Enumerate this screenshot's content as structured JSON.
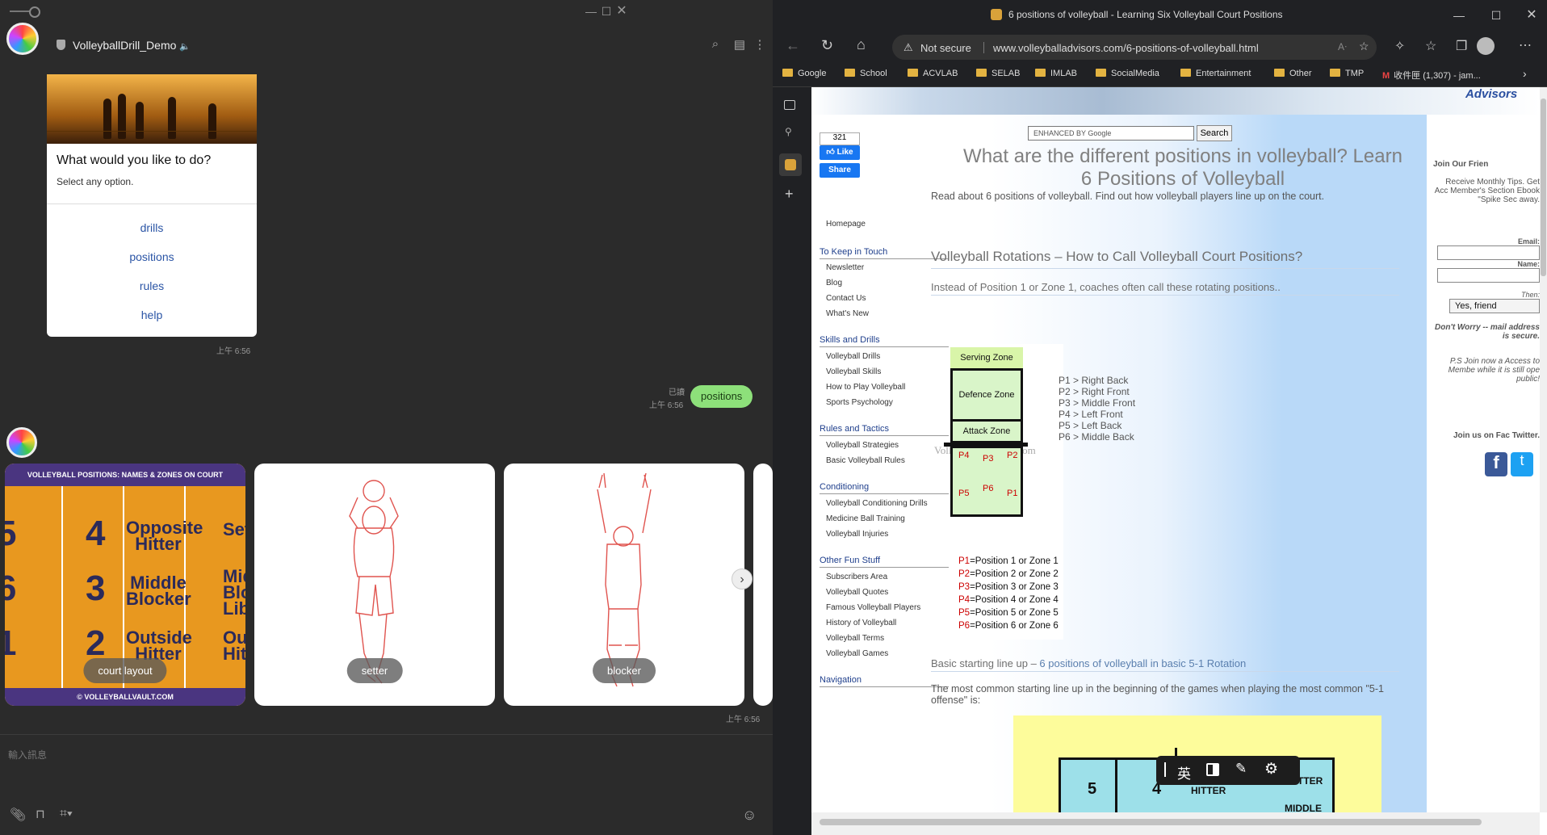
{
  "line": {
    "chat_title": "VolleyballDrill_Demo",
    "card": {
      "title": "What would you like to do?",
      "subtitle": "Select any option.",
      "options": [
        "drills",
        "positions",
        "rules",
        "help"
      ],
      "time": "上午 6:56"
    },
    "sent": {
      "text": "positions",
      "read": "已讀",
      "time": "上午 6:56"
    },
    "carousel": [
      {
        "label": "court layout"
      },
      {
        "label": "setter"
      },
      {
        "label": "blocker"
      }
    ],
    "carousel_time": "上午 6:56",
    "court_image": {
      "header": "VOLLEYBALL POSITIONS: NAMES & ZONES ON COURT",
      "footer": "© VOLLEYBALLVAULT.COM",
      "numbers": [
        "4",
        "3",
        "2",
        "5",
        "6",
        "1"
      ],
      "names": [
        "Opposite Hitter",
        "Middle Blocker",
        "Outside Hitter",
        "Set",
        "Mid Bloc Libe",
        "Out Hit"
      ]
    },
    "input_placeholder": "輸入訊息"
  },
  "browser": {
    "tab_title": "6 positions of volleyball - Learning Six Volleyball Court Positions",
    "not_secure": "Not secure",
    "url": "www.volleyballadvisors.com/6-positions-of-volleyball.html",
    "bookmarks": [
      "Google",
      "School",
      "ACVLAB",
      "SELAB",
      "IMLAB",
      "SocialMedia",
      "Entertainment",
      "Other",
      "TMP",
      "收件匣 (1,307) - jam..."
    ],
    "page": {
      "logo_text": "Advisors",
      "like_count": "321",
      "like_label": "Like",
      "share_label": "Share",
      "search_placeholder": "ENHANCED BY Google",
      "search_button": "Search",
      "heading": "What are the different positions in volleyball? Learn 6 Positions of Volleyball",
      "intro": "Read about 6 positions of volleyball. Find out how volleyball players line up on the court.",
      "nav": {
        "homepage": "Homepage",
        "sections": [
          {
            "title": "To Keep in Touch",
            "items": [
              "Newsletter",
              "Blog",
              "Contact Us",
              "What's New"
            ]
          },
          {
            "title": "Skills and Drills",
            "items": [
              "Volleyball Drills",
              "Volleyball Skills",
              "How to Play Volleyball",
              "Sports Psychology"
            ]
          },
          {
            "title": "Rules and Tactics",
            "items": [
              "Volleyball Strategies",
              "Basic Volleyball Rules"
            ]
          },
          {
            "title": "Conditioning",
            "items": [
              "Volleyball Conditioning Drills",
              "Medicine Ball Training",
              "Volleyball Injuries"
            ]
          },
          {
            "title": "Other Fun Stuff",
            "items": [
              "Subscribers Area",
              "Volleyball Quotes",
              "Famous Volleyball Players",
              "History of Volleyball",
              "Volleyball Terms",
              "Volleyball Games"
            ]
          },
          {
            "title": "Navigation",
            "items": []
          }
        ]
      },
      "section1_title": "Volleyball Rotations – How to Call Volleyball Court Positions?",
      "section1_sub": "Instead of Position 1 or Zone 1, coaches often call these rotating positions..",
      "diagram": {
        "serving": "Serving Zone",
        "defence": "Defence Zone",
        "attack": "Attack Zone",
        "watermark": "VolleyballAdvisors.com",
        "positions": [
          "P4",
          "P3",
          "P2",
          "P5",
          "P6",
          "P1"
        ],
        "legend": [
          {
            "p": "P1",
            "t": "=Position 1 or Zone 1"
          },
          {
            "p": "P2",
            "t": "=Position 2 or Zone 2"
          },
          {
            "p": "P3",
            "t": "=Position 3 or Zone 3"
          },
          {
            "p": "P4",
            "t": "=Position 4 or Zone 4"
          },
          {
            "p": "P5",
            "t": "=Position 5 or Zone 5"
          },
          {
            "p": "P6",
            "t": "=Position 6 or Zone 6"
          }
        ]
      },
      "rotation_names": [
        "P1 > Right Back",
        "P2 > Right Front",
        "P3 > Middle Front",
        "P4 > Left Front",
        "P5 > Left Back",
        "P6 > Middle Back"
      ],
      "section2_title_a": "Basic starting line up – ",
      "section2_title_b": "6 positions of volleyball in basic 5-1 Rotation",
      "section2_text": "The most common starting line up in the beginning of the games when playing the most common \"5-1 offense\" is:",
      "lineup": {
        "n5": "5",
        "n4": "4",
        "hitter": "HITTER",
        "setter": "SETTER",
        "middle": "MIDDLE"
      },
      "right": {
        "join_friends": "Join Our Frien",
        "receive": "Receive Monthly Tips. Get Acc Member's Section Ebook \"Spike Sec away.",
        "email": "Email:",
        "name": "Name:",
        "then": "Then:",
        "yes": "Yes, friend",
        "dont_worry": "Don't Worry -- mail address is secure.",
        "ps": "P.S Join now a Access to Membe while it is still ope public!",
        "join_fb": "Join us on Fac Twitter."
      }
    },
    "ime": {
      "lang": "英"
    }
  }
}
